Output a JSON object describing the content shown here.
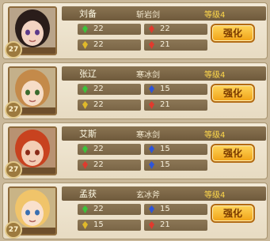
{
  "colors": {
    "gem_green": "#3cc43c",
    "gem_red": "#e03a2e",
    "gem_blue": "#2f55d8",
    "gem_gold": "#e0b92a"
  },
  "cards": [
    {
      "name": "刘备",
      "weapon": "斩岩剑",
      "stage": "等级4",
      "level": "27",
      "button": "强化",
      "stats": [
        {
          "value": "22",
          "gem": "green"
        },
        {
          "value": "22",
          "gem": "red"
        },
        {
          "value": "22",
          "gem": "gold"
        },
        {
          "value": "21",
          "gem": "red"
        }
      ]
    },
    {
      "name": "张辽",
      "weapon": "寒冰剑",
      "stage": "等级4",
      "level": "27",
      "button": "强化",
      "stats": [
        {
          "value": "22",
          "gem": "green"
        },
        {
          "value": "15",
          "gem": "blue"
        },
        {
          "value": "22",
          "gem": "gold"
        },
        {
          "value": "21",
          "gem": "red"
        }
      ]
    },
    {
      "name": "艾斯",
      "weapon": "寒冰剑",
      "stage": "等级4",
      "level": "27",
      "button": "强化",
      "stats": [
        {
          "value": "22",
          "gem": "green"
        },
        {
          "value": "15",
          "gem": "blue"
        },
        {
          "value": "22",
          "gem": "red"
        },
        {
          "value": "15",
          "gem": "blue"
        }
      ]
    },
    {
      "name": "孟获",
      "weapon": "玄冰斧",
      "stage": "等级4",
      "level": "27",
      "button": "强化",
      "stats": [
        {
          "value": "22",
          "gem": "green"
        },
        {
          "value": "15",
          "gem": "blue"
        },
        {
          "value": "15",
          "gem": "gold"
        },
        {
          "value": "21",
          "gem": "red"
        }
      ]
    }
  ]
}
